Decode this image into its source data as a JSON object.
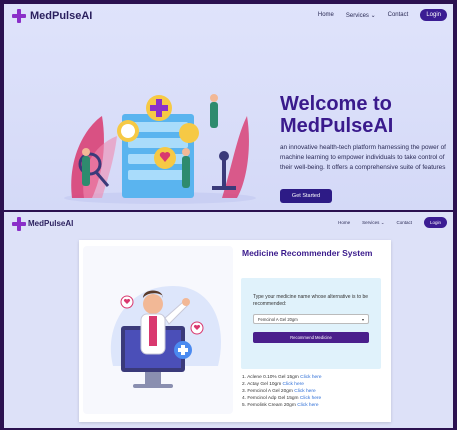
{
  "brand": {
    "name": "MedPulseAI"
  },
  "nav": {
    "home": "Home",
    "services": "Services",
    "contact": "Contact",
    "login": "Login"
  },
  "hero": {
    "title": "Welcome to MedPulseAI",
    "text": "an innovative health-tech platform harnessing the power of machine learning to empower individuals to take control of their well-being. It offers a comprehensive suite of features",
    "button": "Get Started"
  },
  "recommender": {
    "title": "Medicine Recommender System",
    "label": "Type your medicine name whose alternative is to be recommended:",
    "selected": "Femcinol A Gel 20gm",
    "button": "Recommend Medicine",
    "click_text": "Click here",
    "results": [
      "1. Aclene 0.10% Gel 15gm",
      "2. Actay Gel 10gm",
      "3. Femcinol A Gel 20gm",
      "4. Femcinol Adp Gel 15gm",
      "5. Femolink Cream 20gm"
    ]
  },
  "colors": {
    "accent": "#3a1a8c",
    "button": "#2d1b86",
    "background": "#2b1150",
    "link": "#2b6cd6"
  }
}
